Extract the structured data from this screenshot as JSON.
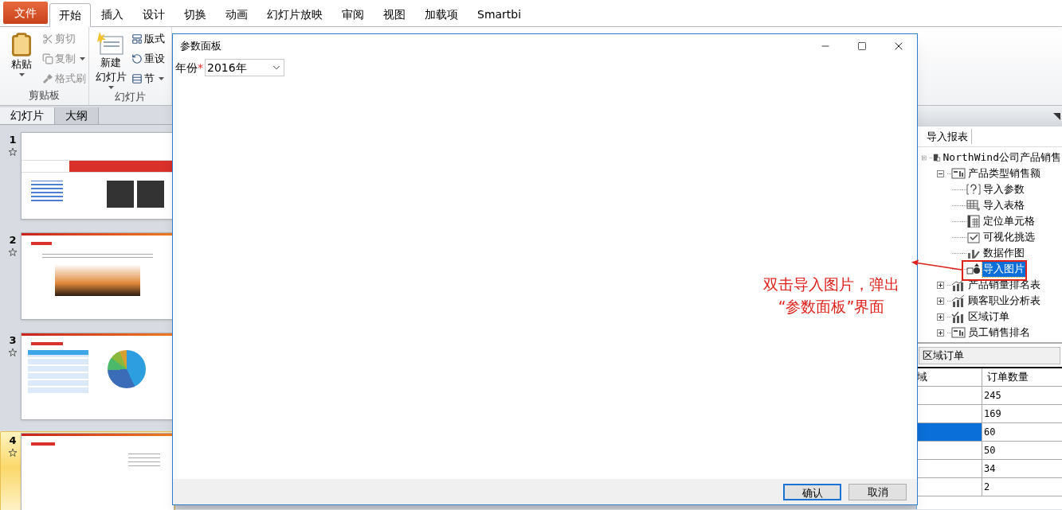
{
  "ribbon": {
    "file_tab": "文件",
    "tabs": [
      {
        "label": "开始",
        "selected": true
      },
      {
        "label": "插入",
        "selected": false
      },
      {
        "label": "设计",
        "selected": false
      },
      {
        "label": "切换",
        "selected": false
      },
      {
        "label": "动画",
        "selected": false
      },
      {
        "label": "幻灯片放映",
        "selected": false
      },
      {
        "label": "审阅",
        "selected": false
      },
      {
        "label": "视图",
        "selected": false
      },
      {
        "label": "加载项",
        "selected": false
      },
      {
        "label": "Smartbi",
        "selected": false
      }
    ],
    "groups": [
      {
        "title": "剪贴板",
        "large": {
          "lines": [
            "粘贴"
          ],
          "kind": "paste",
          "dropdown": true
        },
        "small": [
          {
            "label": "剪切",
            "kind": "cut",
            "disabled": true,
            "dropdown": false
          },
          {
            "label": "复制",
            "kind": "copy",
            "disabled": true,
            "dropdown": true
          },
          {
            "label": "格式刷",
            "kind": "brush",
            "disabled": true,
            "dropdown": false
          }
        ]
      },
      {
        "title": "幻灯片",
        "large": {
          "lines": [
            "新建",
            "幻灯片"
          ],
          "kind": "new-slide",
          "dropdown": true
        },
        "small": [
          {
            "label": "版式",
            "kind": "layout",
            "disabled": false,
            "dropdown": false
          },
          {
            "label": "重设",
            "kind": "reset",
            "disabled": false,
            "dropdown": false
          },
          {
            "label": "节",
            "kind": "section",
            "disabled": false,
            "dropdown": true
          }
        ]
      }
    ]
  },
  "slide_pane": {
    "tabs": [
      {
        "label": "幻灯片",
        "selected": true
      },
      {
        "label": "大纲",
        "selected": false
      }
    ],
    "slides": [
      {
        "number": "1",
        "kind": "title",
        "selected": false
      },
      {
        "number": "2",
        "kind": "photo",
        "selected": false
      },
      {
        "number": "3",
        "kind": "chart",
        "selected": false
      },
      {
        "number": "4",
        "kind": "text",
        "selected": true
      }
    ]
  },
  "dialog": {
    "title": "参数面板",
    "field": {
      "label": "年份",
      "required_mark": "*",
      "value": "2016年"
    },
    "buttons": [
      {
        "label": "确认",
        "default": true
      },
      {
        "label": "取消",
        "default": false
      }
    ]
  },
  "annotation": {
    "lines": [
      "双击导入图片，弹出",
      "“参数面板”界面"
    ]
  },
  "right_panel": {
    "toolbar_button": "导入报表",
    "tree": [
      {
        "label": "NorthWind公司产品销售",
        "kind": "report",
        "expanded": true,
        "children": [
          {
            "label": "产品类型销售额",
            "kind": "sheet",
            "expanded": true,
            "children": [
              {
                "label": "导入参数",
                "kind": "param",
                "selected": false
              },
              {
                "label": "导入表格",
                "kind": "table",
                "selected": false
              },
              {
                "label": "定位单元格",
                "kind": "cell",
                "selected": false
              },
              {
                "label": "可视化挑选",
                "kind": "filter",
                "selected": false
              },
              {
                "label": "数据作图",
                "kind": "chart",
                "selected": false
              },
              {
                "label": "导入图片",
                "kind": "image",
                "selected": true
              }
            ]
          },
          {
            "label": "产品销量排名表",
            "kind": "bars",
            "expanded": false
          },
          {
            "label": "顾客职业分析表",
            "kind": "bars",
            "expanded": false
          },
          {
            "label": "区域订单",
            "kind": "bars-check",
            "expanded": false
          },
          {
            "label": "员工销售排名",
            "kind": "sheet",
            "expanded": false
          }
        ]
      }
    ],
    "table_title": "区域订单",
    "table": {
      "columns": [
        "域",
        "订单数量"
      ],
      "rows": [
        {
          "value": "245",
          "selected": false
        },
        {
          "value": "169",
          "selected": false
        },
        {
          "value": "60",
          "selected": true
        },
        {
          "value": "50",
          "selected": false
        },
        {
          "value": "34",
          "selected": false
        },
        {
          "value": "2",
          "selected": false
        }
      ]
    }
  }
}
